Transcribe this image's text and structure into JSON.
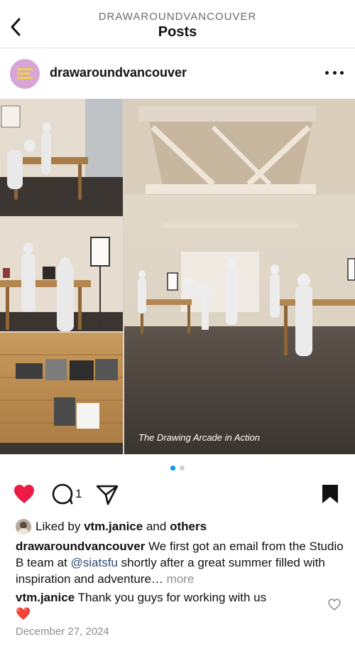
{
  "header": {
    "kicker": "DRAWAROUNDVANCOUVER",
    "title": "Posts"
  },
  "post": {
    "username": "drawaroundvancouver",
    "image_caption": "The Drawing Arcade in Action",
    "carousel": {
      "total": 2,
      "active_index": 0
    },
    "comment_count": "1",
    "liked": true,
    "saved": true,
    "likes": {
      "prefix": "Liked by",
      "user": "vtm.janice",
      "conjunction": "and",
      "others": "others"
    },
    "caption": {
      "username": "drawaroundvancouver",
      "text_before": "We first got an email from the Studio B team at",
      "mention": "@siatsfu",
      "text_after": "shortly after a great summer filled with inspiration and adventure…",
      "more": "more"
    },
    "top_comment": {
      "username": "vtm.janice",
      "text": "Thank you guys for working with us",
      "emoji": "❤️"
    },
    "date": "December 27, 2024"
  },
  "colors": {
    "like_red": "#ed1c45",
    "carousel_active": "#0a95f2",
    "carousel_inactive": "#cfcfcf",
    "avatar_bg": "#d7a6d6"
  },
  "icons": [
    "back-arrow-icon",
    "more-dots-icon",
    "heart-filled-icon",
    "comment-icon",
    "share-icon",
    "bookmark-filled-icon",
    "heart-outline-icon"
  ]
}
